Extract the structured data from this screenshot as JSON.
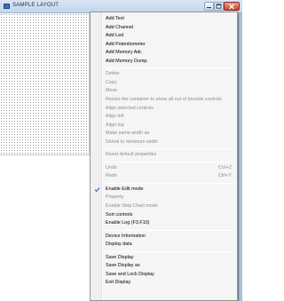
{
  "window": {
    "title": "SAMPLE LAYOUT"
  },
  "menu": {
    "groups": [
      [
        {
          "label": "Add Text",
          "enabled": true
        },
        {
          "label": "Add Channel",
          "enabled": true
        },
        {
          "label": "Add Led",
          "enabled": true
        },
        {
          "label": "Add Potentiometer",
          "enabled": true
        },
        {
          "label": "Add Memory Adr.",
          "enabled": true
        },
        {
          "label": "Add Memory Dump.",
          "enabled": true
        }
      ],
      [
        {
          "label": "Delete",
          "enabled": false
        },
        {
          "label": "Copy",
          "enabled": false
        },
        {
          "label": "Move",
          "enabled": false
        },
        {
          "label": "Resize the container to show all out of bounds controls",
          "enabled": false
        },
        {
          "label": "Align selected controls",
          "enabled": false
        },
        {
          "label": "Align left",
          "enabled": false
        },
        {
          "label": "Align top",
          "enabled": false
        },
        {
          "label": "Make same width as",
          "enabled": false
        },
        {
          "label": "Shrink to minimum width",
          "enabled": false
        }
      ],
      [
        {
          "label": "Reset default properties",
          "enabled": false
        }
      ],
      [
        {
          "label": "Undo",
          "shortcut": "Ctrl+Z",
          "enabled": false
        },
        {
          "label": "Redo",
          "shortcut": "Ctrl+Y",
          "enabled": false
        }
      ],
      [
        {
          "label": "Enable Edit mode",
          "enabled": true,
          "checked": true
        },
        {
          "label": "Property",
          "enabled": false
        },
        {
          "label": "Enable Strip Chart mode",
          "enabled": false
        },
        {
          "label": "Sort controls",
          "enabled": true
        },
        {
          "label": "Enable Log  (F3,F10)",
          "enabled": true
        }
      ],
      [
        {
          "label": "Device Information",
          "enabled": true
        },
        {
          "label": "Display data",
          "enabled": true
        }
      ],
      [
        {
          "label": "Save Display",
          "enabled": true
        },
        {
          "label": "Save Display as",
          "enabled": true
        },
        {
          "label": "Save and Lock Display",
          "enabled": true
        },
        {
          "label": "Exit Display",
          "enabled": true
        }
      ]
    ]
  },
  "colors": {
    "check": "#3b6fb6",
    "disabled_text": "#8c8c8c"
  },
  "icons": {
    "app": "app-icon",
    "minimize": "minimize-icon",
    "maximize": "maximize-icon",
    "close": "close-icon",
    "check": "checkmark-icon"
  }
}
